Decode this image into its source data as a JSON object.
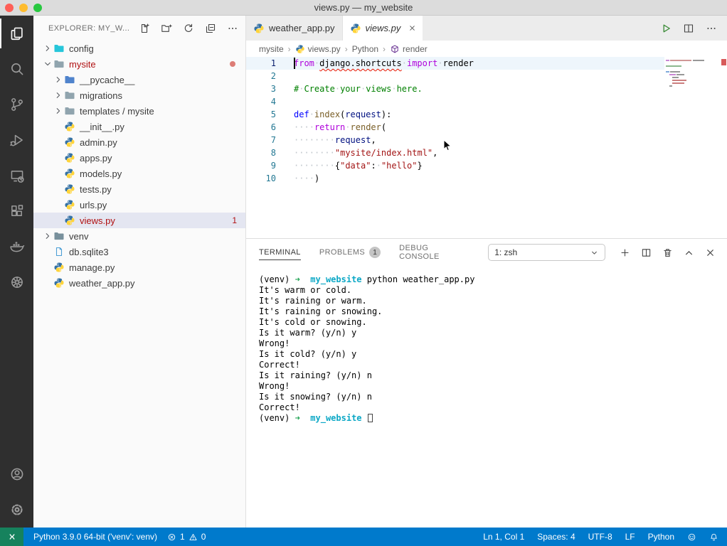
{
  "window": {
    "title": "views.py — my_website"
  },
  "activity_bar": {
    "top": [
      {
        "name": "explorer",
        "active": true
      },
      {
        "name": "search",
        "active": false
      },
      {
        "name": "source-control",
        "active": false
      },
      {
        "name": "run-debug",
        "active": false
      },
      {
        "name": "remote-explorer",
        "active": false
      },
      {
        "name": "extensions",
        "active": false
      },
      {
        "name": "docker",
        "active": false
      },
      {
        "name": "kubernetes",
        "active": false
      }
    ],
    "bottom": [
      {
        "name": "account",
        "active": false
      },
      {
        "name": "settings",
        "active": false
      }
    ]
  },
  "sidebar": {
    "title": "EXPLORER: MY_W...",
    "toolbar": [
      "new-file",
      "new-folder",
      "refresh",
      "collapse-all",
      "more"
    ],
    "tree": [
      {
        "label": "config",
        "kind": "folder",
        "level": 0,
        "expanded": false,
        "folder_color": "#26c6da"
      },
      {
        "label": "mysite",
        "kind": "folder",
        "level": 0,
        "expanded": true,
        "text_color": "#b01011",
        "dot": true,
        "folder_color": "#90a4ae"
      },
      {
        "label": "__pycache__",
        "kind": "folder",
        "level": 1,
        "expanded": false,
        "folder_color": "#4f83cc"
      },
      {
        "label": "migrations",
        "kind": "folder",
        "level": 1,
        "expanded": false,
        "folder_color": "#90a4ae"
      },
      {
        "label": "templates / mysite",
        "kind": "folder",
        "level": 1,
        "expanded": false,
        "folder_color": "#90a4ae"
      },
      {
        "label": "__init__.py",
        "kind": "python",
        "level": 1
      },
      {
        "label": "admin.py",
        "kind": "python",
        "level": 1
      },
      {
        "label": "apps.py",
        "kind": "python",
        "level": 1
      },
      {
        "label": "models.py",
        "kind": "python",
        "level": 1
      },
      {
        "label": "tests.py",
        "kind": "python",
        "level": 1
      },
      {
        "label": "urls.py",
        "kind": "python",
        "level": 1
      },
      {
        "label": "views.py",
        "kind": "python",
        "level": 1,
        "selected": true,
        "text_color": "#b01011",
        "badge": "1"
      },
      {
        "label": "venv",
        "kind": "folder",
        "level": 0,
        "expanded": false,
        "folder_color": "#78909c"
      },
      {
        "label": "db.sqlite3",
        "kind": "file",
        "level": 0
      },
      {
        "label": "manage.py",
        "kind": "python",
        "level": 0
      },
      {
        "label": "weather_app.py",
        "kind": "python",
        "level": 0
      }
    ]
  },
  "editor": {
    "tabs": [
      {
        "label": "weather_app.py",
        "active": false,
        "preview": false
      },
      {
        "label": "views.py",
        "active": true,
        "preview": true
      }
    ],
    "breadcrumb": [
      {
        "label": "mysite",
        "icon": null
      },
      {
        "label": "views.py",
        "icon": "python"
      },
      {
        "label": "Python",
        "icon": null
      },
      {
        "label": "render",
        "icon": "symbol-method"
      }
    ],
    "code": [
      {
        "n": "1",
        "current": true,
        "segs": [
          [
            "kw",
            "from"
          ],
          [
            "pl",
            " "
          ],
          [
            "pl err",
            "django.shortcuts"
          ],
          [
            "pl",
            " "
          ],
          [
            "kw",
            "import"
          ],
          [
            "pl",
            " render"
          ]
        ]
      },
      {
        "n": "2",
        "segs": []
      },
      {
        "n": "3",
        "segs": [
          [
            "com",
            "# Create your views here."
          ]
        ]
      },
      {
        "n": "4",
        "segs": []
      },
      {
        "n": "5",
        "segs": [
          [
            "kwb",
            "def"
          ],
          [
            "pl",
            " "
          ],
          [
            "fn",
            "index"
          ],
          [
            "pl",
            "("
          ],
          [
            "prm",
            "request"
          ],
          [
            "pl",
            "):"
          ]
        ]
      },
      {
        "n": "6",
        "segs": [
          [
            "pl",
            "    "
          ],
          [
            "kw",
            "return"
          ],
          [
            "pl",
            " "
          ],
          [
            "fn",
            "render"
          ],
          [
            "pl",
            "("
          ]
        ]
      },
      {
        "n": "7",
        "segs": [
          [
            "pl",
            "        "
          ],
          [
            "prm",
            "request"
          ],
          [
            "pl",
            ","
          ]
        ]
      },
      {
        "n": "8",
        "segs": [
          [
            "pl",
            "        "
          ],
          [
            "str",
            "\"mysite/index.html\""
          ],
          [
            "pl",
            ","
          ]
        ]
      },
      {
        "n": "9",
        "segs": [
          [
            "pl",
            "        {"
          ],
          [
            "str",
            "\"data\""
          ],
          [
            "pl",
            ": "
          ],
          [
            "str",
            "\"hello\""
          ],
          [
            "pl",
            "}"
          ]
        ]
      },
      {
        "n": "10",
        "segs": [
          [
            "pl",
            "    )"
          ]
        ]
      }
    ]
  },
  "panel": {
    "tabs": [
      {
        "label": "TERMINAL",
        "active": true
      },
      {
        "label": "PROBLEMS",
        "active": false,
        "badge": "1"
      },
      {
        "label": "DEBUG CONSOLE",
        "active": false
      }
    ],
    "shell_selector": "1: zsh",
    "actions": [
      "new-terminal",
      "split-terminal",
      "kill-terminal",
      "maximize-panel",
      "close-panel"
    ],
    "lines": [
      {
        "segs": [
          [
            "pl",
            "(venv) "
          ],
          [
            "grn",
            "➜"
          ],
          [
            "pl",
            "  "
          ],
          [
            "cyn",
            "my_website"
          ],
          [
            "pl",
            " python weather_app.py"
          ]
        ]
      },
      {
        "segs": [
          [
            "pl",
            "It's warm or cold."
          ]
        ]
      },
      {
        "segs": [
          [
            "pl",
            "It's raining or warm."
          ]
        ]
      },
      {
        "segs": [
          [
            "pl",
            "It's raining or snowing."
          ]
        ]
      },
      {
        "segs": [
          [
            "pl",
            "It's cold or snowing."
          ]
        ]
      },
      {
        "segs": [
          [
            "pl",
            "Is it warm? (y/n) y"
          ]
        ]
      },
      {
        "segs": [
          [
            "pl",
            "Wrong!"
          ]
        ]
      },
      {
        "segs": [
          [
            "pl",
            "Is it cold? (y/n) y"
          ]
        ]
      },
      {
        "segs": [
          [
            "pl",
            "Correct!"
          ]
        ]
      },
      {
        "segs": [
          [
            "pl",
            "Is it raining? (y/n) n"
          ]
        ]
      },
      {
        "segs": [
          [
            "pl",
            "Wrong!"
          ]
        ]
      },
      {
        "segs": [
          [
            "pl",
            "Is it snowing? (y/n) n"
          ]
        ]
      },
      {
        "segs": [
          [
            "pl",
            "Correct!"
          ]
        ]
      },
      {
        "segs": [
          [
            "pl",
            "(venv) "
          ],
          [
            "grn",
            "➜"
          ],
          [
            "pl",
            "  "
          ],
          [
            "cyn",
            "my_website"
          ],
          [
            "pl",
            " "
          ],
          [
            "cursor",
            ""
          ]
        ]
      }
    ]
  },
  "status_bar": {
    "left": [
      {
        "type": "remote",
        "name": "remote-indicator"
      },
      {
        "type": "text",
        "label": "Python 3.9.0 64-bit ('venv': venv)",
        "name": "python-interpreter"
      },
      {
        "type": "problems",
        "errors": "1",
        "warnings": "0",
        "name": "problems-summary"
      }
    ],
    "right": [
      {
        "type": "text",
        "label": "Ln 1, Col 1",
        "name": "cursor-position"
      },
      {
        "type": "text",
        "label": "Spaces: 4",
        "name": "indentation"
      },
      {
        "type": "text",
        "label": "UTF-8",
        "name": "encoding"
      },
      {
        "type": "text",
        "label": "LF",
        "name": "eol"
      },
      {
        "type": "text",
        "label": "Python",
        "name": "language-mode"
      },
      {
        "type": "icon",
        "icon": "feedback",
        "name": "feedback"
      },
      {
        "type": "icon",
        "icon": "bell",
        "name": "notifications"
      }
    ],
    "colors": {
      "background": "#007acc",
      "remote_background": "#16825d"
    }
  }
}
